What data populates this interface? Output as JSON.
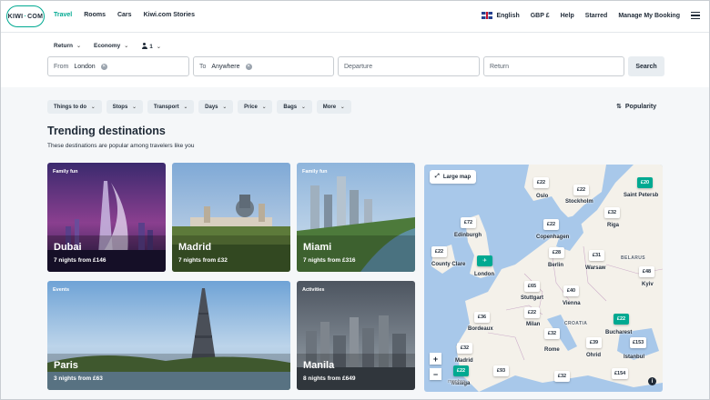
{
  "nav": {
    "logo_main": "KIWI",
    "logo_sep": "·",
    "logo_tld": "COM",
    "links": [
      "Travel",
      "Rooms",
      "Cars",
      "Kiwi.com Stories"
    ],
    "language": "English",
    "currency": "GBP £",
    "help": "Help",
    "starred": "Starred",
    "manage": "Manage My Booking"
  },
  "search": {
    "trip_type": "Return",
    "cabin": "Economy",
    "passengers": "1",
    "from_label": "From",
    "from_value": "London",
    "to_label": "To",
    "to_value": "Anywhere",
    "departure_placeholder": "Departure",
    "return_placeholder": "Return",
    "search_button": "Search"
  },
  "filters": [
    "Things to do",
    "Stops",
    "Transport",
    "Days",
    "Price",
    "Bags",
    "More"
  ],
  "sort": "Popularity",
  "heading": {
    "title": "Trending destinations",
    "subtitle": "These destinations are popular among travelers like you"
  },
  "cards": [
    {
      "tag": "Family fun",
      "city": "Dubai",
      "sub": "7 nights from £146"
    },
    {
      "tag": "",
      "city": "Madrid",
      "sub": "7 nights from £32"
    },
    {
      "tag": "Family fun",
      "city": "Miami",
      "sub": "7 nights from £316"
    },
    {
      "tag": "Events",
      "city": "Paris",
      "sub": "3 nights from £63"
    },
    {
      "tag": "Activities",
      "city": "Manila",
      "sub": "8 nights from £649"
    }
  ],
  "map": {
    "large_map": "Large map",
    "zoom_in": "+",
    "zoom_out": "−",
    "info": "i",
    "pins": [
      "£22",
      "£20",
      "£22",
      "£72",
      "£32",
      "£22",
      "£22",
      "£28",
      "£31",
      "£48",
      "£65",
      "£40",
      "£36",
      "£22",
      "£22",
      "£32",
      "£39",
      "£153",
      "£32",
      "£22",
      "£93",
      "£32",
      "£154"
    ],
    "cities": [
      "Oslo",
      "Stockholm",
      "Saint Petersb",
      "Riga",
      "Edinburgh",
      "Copenhagen",
      "Berlin",
      "Warsaw",
      "Kyiv",
      "London",
      "County Clare",
      "Stuttgart",
      "Vienna",
      "Bordeaux",
      "Milan",
      "Bucharest",
      "Rome",
      "Istanbul",
      "Madrid",
      "Ohrid",
      "Malaga"
    ],
    "countries": [
      "BELARUS",
      "CROATIA"
    ],
    "watermark": "mapbox"
  }
}
